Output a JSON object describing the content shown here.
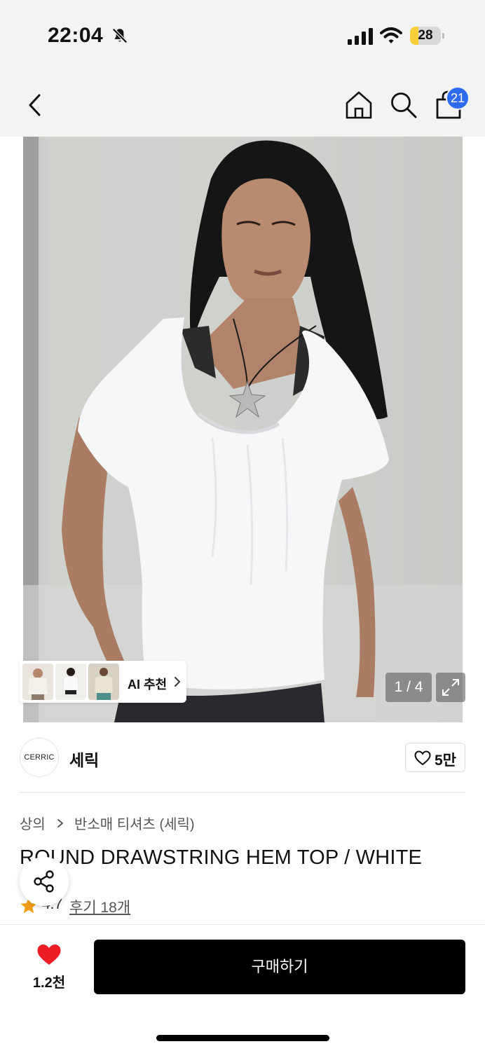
{
  "status_bar": {
    "time": "22:04",
    "battery_level": "28",
    "battery_fraction": 0.28,
    "icons": [
      "bell-slash-icon",
      "cellular-signal-icon",
      "wifi-icon",
      "battery-icon"
    ]
  },
  "nav": {
    "icons": [
      "back-icon",
      "home-icon",
      "search-icon",
      "shopping-bag-icon"
    ],
    "cart_count": "21",
    "badge_color": "#2f6bf0"
  },
  "gallery": {
    "ai_recommend_label": "AI 추천",
    "counter": "1 / 4",
    "icons": [
      "chevron-right-icon",
      "expand-icon"
    ]
  },
  "brand": {
    "logo_text": "CERRIC",
    "name": "세릭",
    "likes": "5만"
  },
  "product": {
    "breadcrumb": [
      "상의",
      "반소매 티셔츠 (세릭)"
    ],
    "title": "ROUND DRAWSTRING HEM TOP / WHITE",
    "rating": "4.7",
    "reviews": "후기 18개",
    "star_color": "#f2a019"
  },
  "bottom_bar": {
    "wish_count": "1.2천",
    "heart_color": "#ee1c25",
    "buy_label": "구매하기"
  }
}
